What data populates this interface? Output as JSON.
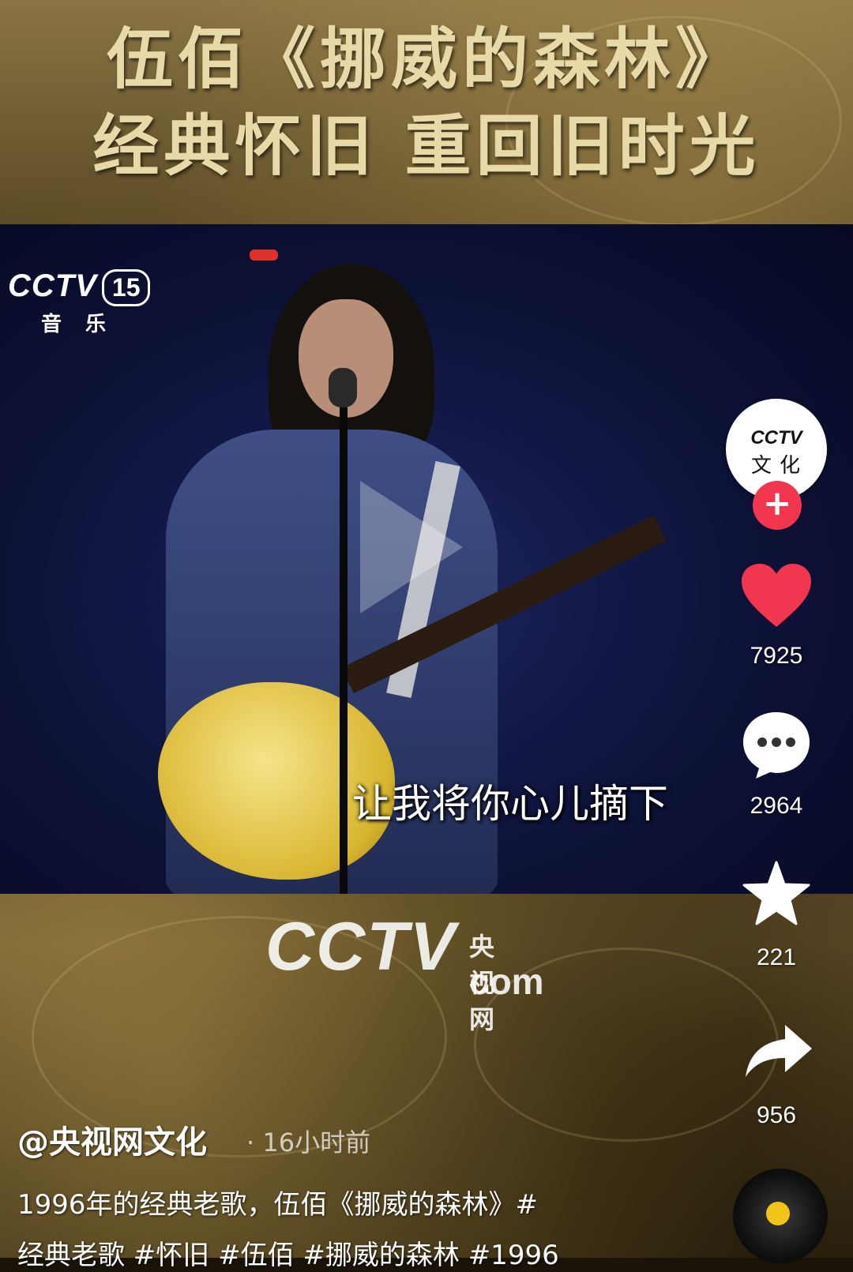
{
  "banner": {
    "line1": "伍佰《挪威的森林》",
    "line2": "经典怀旧 重回旧时光"
  },
  "video": {
    "channel_logo": "CCTV",
    "channel_number": "15",
    "channel_name": "音乐",
    "subtitle": "让我将你心儿摘下",
    "play_icon": "play-icon"
  },
  "watermark": {
    "logo": "CCTV",
    "cn": "央视网",
    "com": "com"
  },
  "actions": {
    "avatar_logo": "CCTV",
    "avatar_sub": "文化",
    "follow": "+",
    "likes": "7925",
    "comments": "2964",
    "favorites": "221",
    "shares": "956",
    "like_color": "#f2364f"
  },
  "post": {
    "author": "@央视网文化",
    "time": "· 16小时前",
    "caption_line1": "1996年的经典老歌，伍佰《挪威的森林》#",
    "caption_line2": "经典老歌 #怀旧 #伍佰 #挪威的森林 #1996"
  }
}
